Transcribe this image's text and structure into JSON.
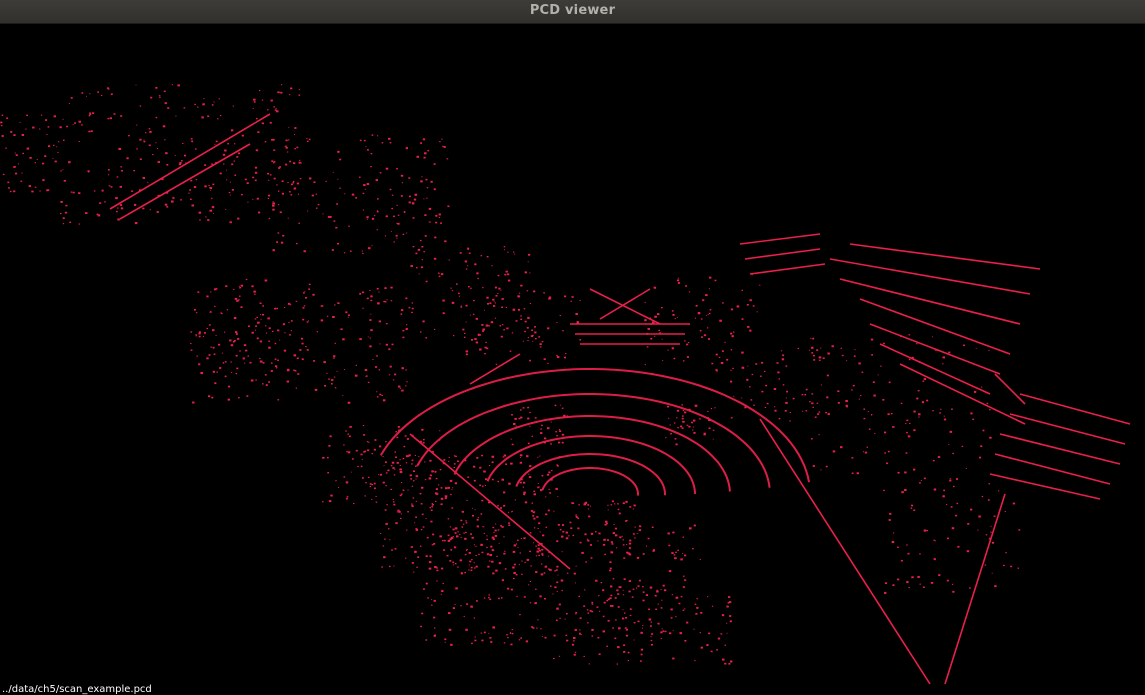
{
  "window": {
    "title": "PCD viewer"
  },
  "viewer": {
    "background_color": "#000000",
    "point_color": "#e8204a",
    "cloud_label": "../data/ch5/scan_example.pcd"
  }
}
